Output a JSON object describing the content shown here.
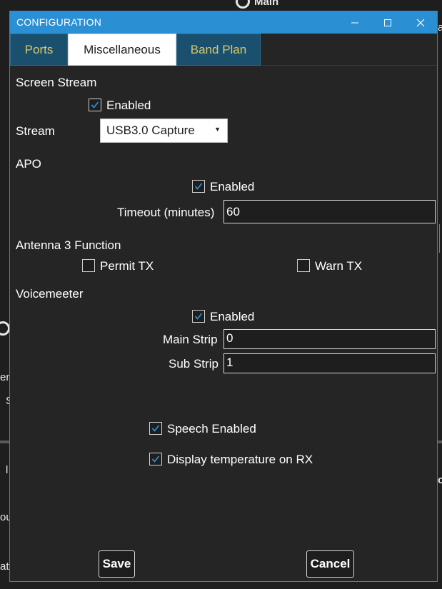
{
  "background": {
    "top_label": "Main",
    "left_fragment_1": "em",
    "left_fragment_2": "S",
    "left_fragment_3": "l",
    "left_fragment_4": "ou",
    "left_fragment_5": "ato",
    "right_fragment_1": "a",
    "right_fragment_2": "o"
  },
  "dialog": {
    "title": "CONFIGURATION",
    "minimize_glyph": "—",
    "maximize_glyph": "☐",
    "close_glyph": "✕"
  },
  "tabs": [
    {
      "label": "Ports",
      "active": false
    },
    {
      "label": "Miscellaneous",
      "active": true
    },
    {
      "label": "Band Plan",
      "active": false
    }
  ],
  "screen_stream": {
    "heading": "Screen Stream",
    "enabled_label": "Enabled",
    "enabled": true,
    "stream_label": "Stream",
    "stream_value": "USB3.0 Capture"
  },
  "apo": {
    "heading": "APO",
    "enabled_label": "Enabled",
    "enabled": true,
    "timeout_label": "Timeout (minutes)",
    "timeout_value": "60"
  },
  "antenna3": {
    "heading": "Antenna 3 Function",
    "permit_tx_label": "Permit TX",
    "permit_tx": false,
    "warn_tx_label": "Warn TX",
    "warn_tx": false
  },
  "voicemeeter": {
    "heading": "Voicemeeter",
    "enabled_label": "Enabled",
    "enabled": true,
    "main_strip_label": "Main Strip",
    "main_strip_value": "0",
    "sub_strip_label": "Sub Strip",
    "sub_strip_value": "1"
  },
  "options": {
    "speech_label": "Speech Enabled",
    "speech": true,
    "temp_label": "Display temperature on RX",
    "temp": true
  },
  "buttons": {
    "save": "Save",
    "cancel": "Cancel"
  },
  "colors": {
    "titlebar": "#2b8fd4",
    "dialog_bg": "#252526",
    "tab_inactive_bg": "#1a4f6e",
    "tab_inactive_text": "#d8c96a",
    "checkmark": "#2b8fd4"
  }
}
